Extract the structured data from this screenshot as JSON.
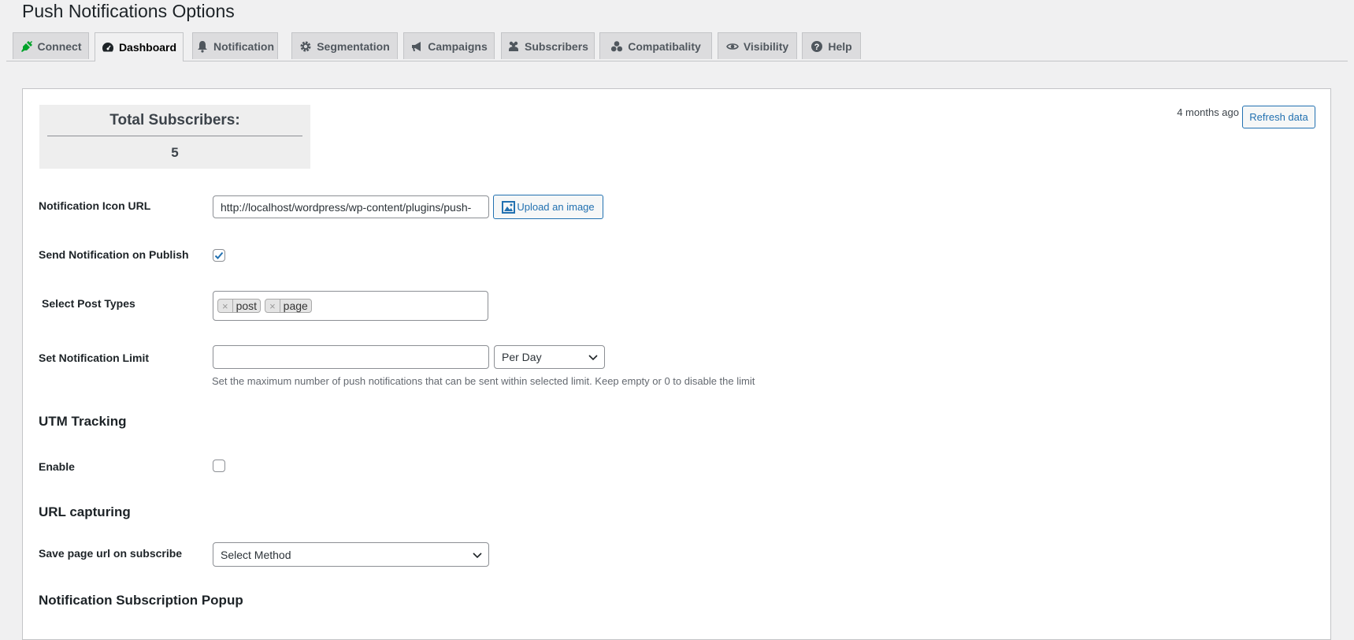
{
  "page": {
    "title": "Push Notifications Options"
  },
  "tabs": [
    {
      "label": "Connect",
      "icon": "plug-icon",
      "active": false
    },
    {
      "label": "Dashboard",
      "icon": "dashboard-icon",
      "active": true
    },
    {
      "label": "Notification",
      "icon": "bell-icon",
      "active": false
    },
    {
      "label": "Segmentation",
      "icon": "gear-icon",
      "active": false
    },
    {
      "label": "Campaigns",
      "icon": "megaphone-icon",
      "active": false
    },
    {
      "label": "Subscribers",
      "icon": "users-icon",
      "active": false
    },
    {
      "label": "Compatibality",
      "icon": "circles-icon",
      "active": false
    },
    {
      "label": "Visibility",
      "icon": "eye-icon",
      "active": false
    },
    {
      "label": "Help",
      "icon": "help-icon",
      "active": false
    }
  ],
  "dashboard": {
    "subscribers_title": "Total Subscribers:",
    "subscribers_count": "5",
    "last_updated": "4 months ago",
    "refresh_label": "Refresh data"
  },
  "form": {
    "icon_url_label": "Notification Icon URL",
    "icon_url_value": "http://localhost/wordpress/wp-content/plugins/push-",
    "upload_label": "Upload an image",
    "publish_label": "Send Notification on Publish",
    "publish_checked": true,
    "post_types_label": "Select Post Types",
    "post_types": [
      "post",
      "page"
    ],
    "limit_label": "Set Notification Limit",
    "limit_value": "",
    "limit_period": "Per Day",
    "limit_help": "Set the maximum number of push notifications that can be sent within selected limit. Keep empty or 0 to disable the limit",
    "utm_heading": "UTM Tracking",
    "utm_enable_label": "Enable",
    "utm_enabled": false,
    "url_heading": "URL capturing",
    "save_url_label": "Save page url on subscribe",
    "save_url_value": "Select Method",
    "popup_heading": "Notification Subscription Popup"
  },
  "colors": {
    "accent": "#2271b1",
    "connect_icon": "#00a32a"
  }
}
